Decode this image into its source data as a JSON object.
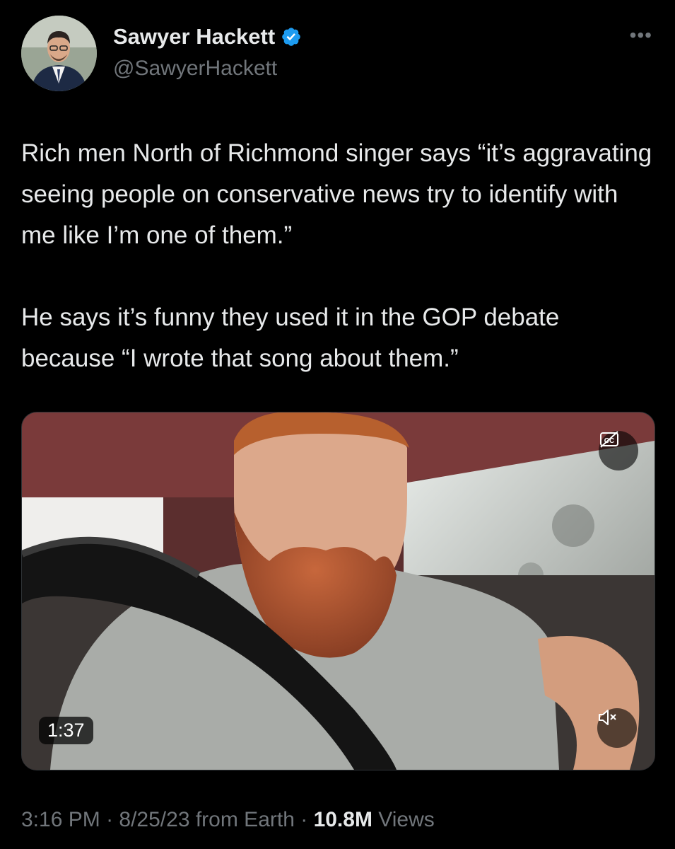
{
  "author": {
    "name": "Sawyer Hackett",
    "handle": "@SawyerHackett"
  },
  "icons": {
    "verified": "verified-badge-icon",
    "more": "more-options-icon",
    "captions": "closed-captions-icon",
    "mute": "muted-speaker-icon"
  },
  "tweet": {
    "paragraph_1": "Rich men North of Richmond singer says “it’s aggravating seeing people on conservative news try to identify with me like I’m one of them.”",
    "paragraph_2": "He says it’s funny they used it in the GOP debate because “I wrote that song about them.”"
  },
  "video": {
    "duration": "1:37"
  },
  "meta": {
    "time": "3:16 PM",
    "separator": " · ",
    "date": "8/25/23",
    "source": "from Earth",
    "views_count": "10.8M",
    "views_label": " Views"
  },
  "colors": {
    "verified": "#1d9bf0",
    "secondary_text": "#71767b",
    "primary_text": "#e7e9ea"
  }
}
